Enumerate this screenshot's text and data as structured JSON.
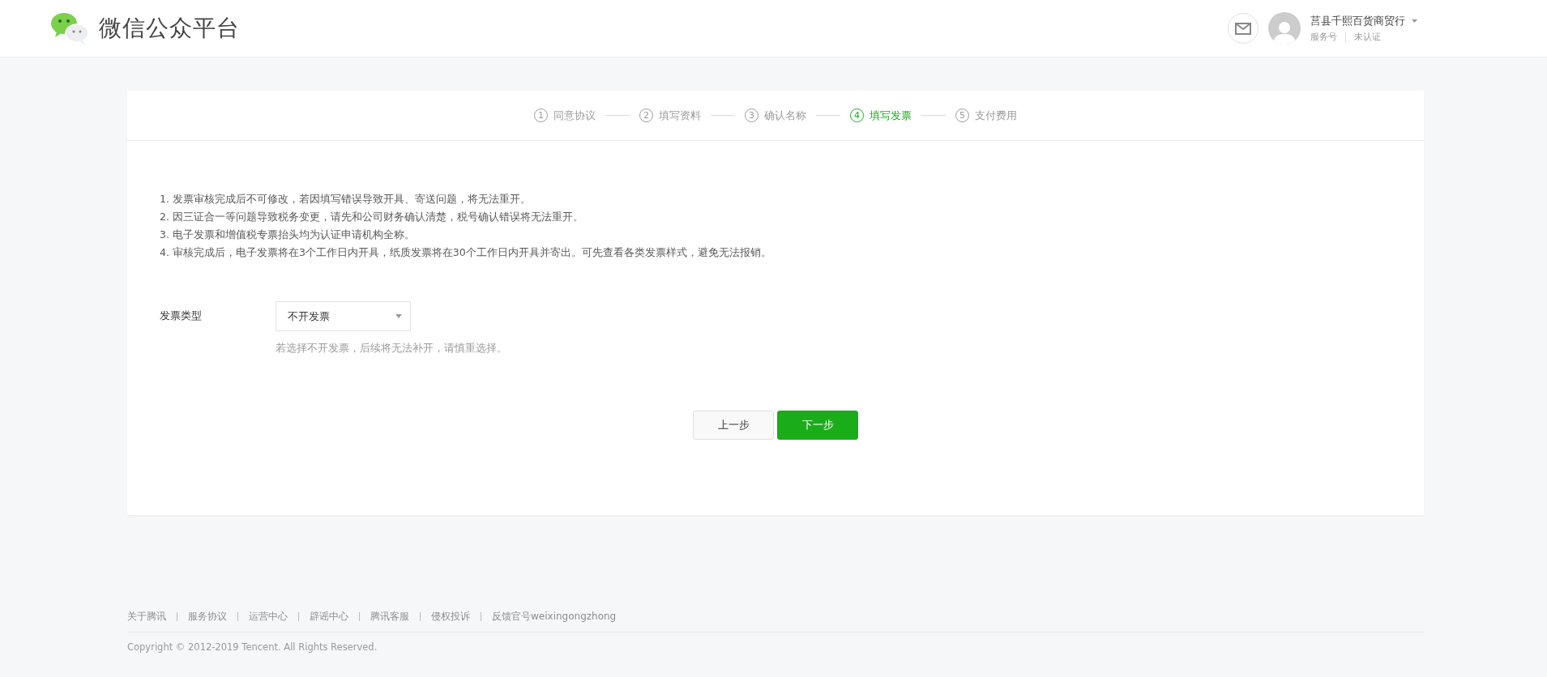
{
  "header": {
    "title": "微信公众平台",
    "account": {
      "name": "莒县千熙百货商贸行",
      "type": "服务号",
      "verification": "未认证"
    }
  },
  "steps": [
    {
      "number": "1",
      "label": "同意协议",
      "selected": false
    },
    {
      "number": "2",
      "label": "填写资料",
      "selected": false
    },
    {
      "number": "3",
      "label": "确认名称",
      "selected": false
    },
    {
      "number": "4",
      "label": "填写发票",
      "selected": true
    },
    {
      "number": "5",
      "label": "支付费用",
      "selected": false
    }
  ],
  "notes": [
    "1. 发票审核完成后不可修改，若因填写错误导致开具、寄送问题，将无法重开。",
    "2. 因三证合一等问题导致税务变更，请先和公司财务确认清楚，税号确认错误将无法重开。",
    "3. 电子发票和增值税专票抬头均为认证申请机构全称。",
    "4. 审核完成后，电子发票将在3个工作日内开具，纸质发票将在30个工作日内开具并寄出。可先查看各类发票样式，避免无法报销。"
  ],
  "form": {
    "label": "发票类型",
    "value": "不开发票",
    "hint": "若选择不开发票，后续将无法补开，请慎重选择。"
  },
  "buttons": [
    {
      "label": "上一步",
      "kind": "secondary"
    },
    {
      "label": "下一步",
      "kind": "primary"
    }
  ],
  "footer": {
    "links": [
      "关于腾讯",
      "服务协议",
      "运营中心",
      "辟谣中心",
      "腾讯客服",
      "侵权投诉",
      "反馈官号weixingongzhong"
    ],
    "copyright": "Copyright © 2012-2019 Tencent. All Rights Reserved."
  }
}
